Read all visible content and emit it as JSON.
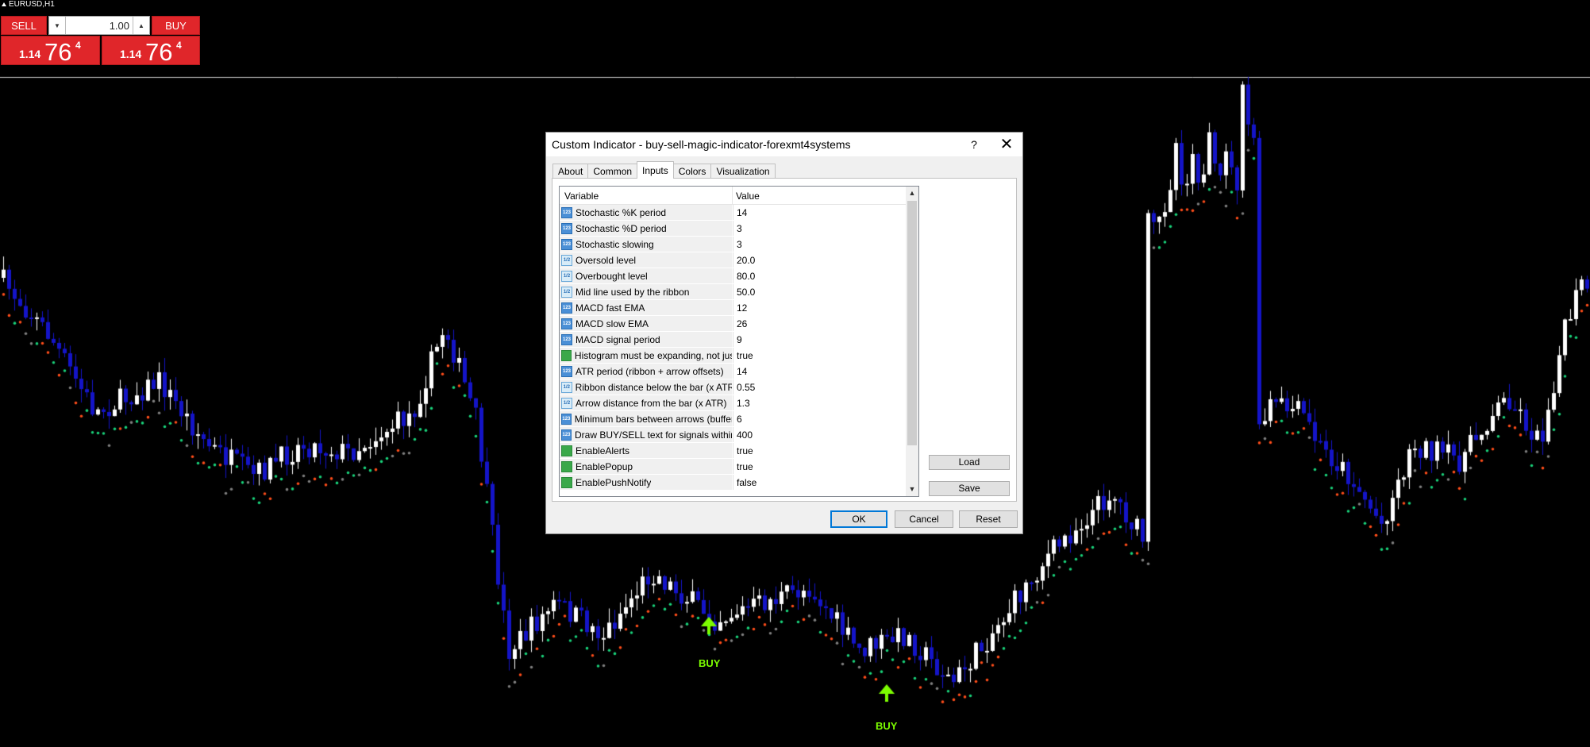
{
  "chart": {
    "symbol_label": "EURUSD,H1",
    "colors": {
      "background": "#000000",
      "bull_candle": "#ffffff",
      "bear_candle": "#1414c8",
      "dot_bull": "#19d27a",
      "dot_bear": "#ff4d1a",
      "dot_neutral": "#808080",
      "arrow_buy": "#7cfc00",
      "hline": "#c8c8c8"
    },
    "arrow_icon": "arrow-up-icon",
    "buy_signals": [
      {
        "label": "BUY"
      },
      {
        "label": "BUY"
      }
    ]
  },
  "trade_panel": {
    "sell_label": "SELL",
    "buy_label": "BUY",
    "lot_value": "1.00",
    "sell_price": {
      "small": "1.14",
      "big": "76",
      "sup": "4"
    },
    "buy_price": {
      "small": "1.14",
      "big": "76",
      "sup": "4"
    }
  },
  "dialog": {
    "title": "Custom Indicator - buy-sell-magic-indicator-forexmt4systems",
    "help_label": "?",
    "close_label": "✕",
    "tabs": [
      "About",
      "Common",
      "Inputs",
      "Colors",
      "Visualization"
    ],
    "active_tab": "Inputs",
    "grid": {
      "headers": {
        "variable": "Variable",
        "value": "Value"
      },
      "rows": [
        {
          "type": "int",
          "icon": "int-type-icon",
          "variable": "Stochastic %K period",
          "value": "14"
        },
        {
          "type": "int",
          "icon": "int-type-icon",
          "variable": "Stochastic %D period",
          "value": "3"
        },
        {
          "type": "int",
          "icon": "int-type-icon",
          "variable": "Stochastic slowing",
          "value": "3"
        },
        {
          "type": "double",
          "icon": "double-type-icon",
          "variable": "Oversold level",
          "value": "20.0"
        },
        {
          "type": "double",
          "icon": "double-type-icon",
          "variable": "Overbought level",
          "value": "80.0"
        },
        {
          "type": "double",
          "icon": "double-type-icon",
          "variable": "Mid line used by the ribbon",
          "value": "50.0"
        },
        {
          "type": "int",
          "icon": "int-type-icon",
          "variable": "MACD fast EMA",
          "value": "12"
        },
        {
          "type": "int",
          "icon": "int-type-icon",
          "variable": "MACD slow EMA",
          "value": "26"
        },
        {
          "type": "int",
          "icon": "int-type-icon",
          "variable": "MACD signal period",
          "value": "9"
        },
        {
          "type": "bool",
          "icon": "bool-type-icon",
          "variable": "Histogram must be expanding, not just ...",
          "value": "true"
        },
        {
          "type": "int",
          "icon": "int-type-icon",
          "variable": "ATR period (ribbon + arrow offsets)",
          "value": "14"
        },
        {
          "type": "double",
          "icon": "double-type-icon",
          "variable": "Ribbon distance below the bar (x ATR)",
          "value": "0.55"
        },
        {
          "type": "double",
          "icon": "double-type-icon",
          "variable": "Arrow distance from the bar (x ATR)",
          "value": "1.3"
        },
        {
          "type": "int",
          "icon": "int-type-icon",
          "variable": "Minimum bars between arrows (buffer-s...",
          "value": "6"
        },
        {
          "type": "int",
          "icon": "int-type-icon",
          "variable": "Draw BUY/SELL text for signals within ...",
          "value": "400"
        },
        {
          "type": "bool",
          "icon": "bool-type-icon",
          "variable": "EnableAlerts",
          "value": "true"
        },
        {
          "type": "bool",
          "icon": "bool-type-icon",
          "variable": "EnablePopup",
          "value": "true"
        },
        {
          "type": "bool",
          "icon": "bool-type-icon",
          "variable": "EnablePushNotify",
          "value": "false"
        }
      ]
    },
    "buttons": {
      "load": "Load",
      "save": "Save",
      "ok": "OK",
      "cancel": "Cancel",
      "reset": "Reset"
    }
  }
}
